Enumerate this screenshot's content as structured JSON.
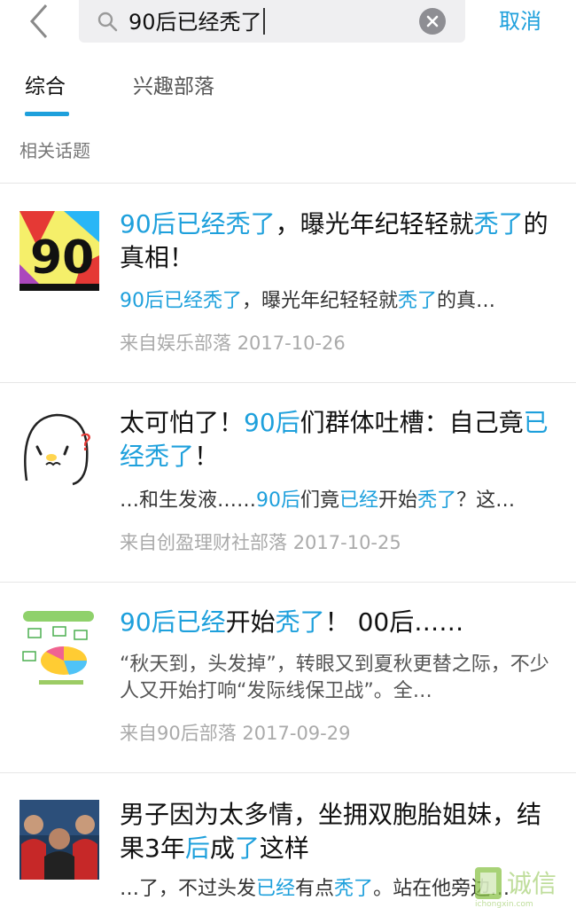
{
  "search": {
    "query": "90后已经秃了",
    "cancel_label": "取消"
  },
  "tabs": [
    {
      "label": "综合",
      "active": true
    },
    {
      "label": "兴趣部落",
      "active": false
    }
  ],
  "section_label": "相关话题",
  "results": [
    {
      "title": [
        [
          "90后已经秃了",
          true
        ],
        [
          "，曝光年纪轻轻就",
          false
        ],
        [
          "秃了",
          true
        ],
        [
          "的真相！",
          false
        ]
      ],
      "snippet": [
        [
          "90后已经秃了",
          true
        ],
        [
          "，曝光年纪轻轻就",
          false
        ],
        [
          "秃了",
          true
        ],
        [
          "的真…",
          false
        ]
      ],
      "source": "来自娱乐部落",
      "date": "2017-10-26",
      "thumb_text": "90"
    },
    {
      "title": [
        [
          "太可怕了！",
          false
        ],
        [
          "90后",
          true
        ],
        [
          "们群体吐槽：自己竟",
          false
        ],
        [
          "已经秃了",
          true
        ],
        [
          "！",
          false
        ]
      ],
      "snippet": [
        [
          "…和生发液……",
          false
        ],
        [
          "90后",
          true
        ],
        [
          "们竟",
          false
        ],
        [
          "已经",
          true
        ],
        [
          "开始",
          false
        ],
        [
          "秃了",
          true
        ],
        [
          "？这…",
          false
        ]
      ],
      "source": "来自创盈理财社部落",
      "date": "2017-10-25"
    },
    {
      "title": [
        [
          "90后已经",
          true
        ],
        [
          "开始",
          false
        ],
        [
          "秃了",
          true
        ],
        [
          "！ 00后……",
          false
        ]
      ],
      "snippet": [
        [
          "“秋天到，头发掉”，转眼又到夏秋更替之际，不少人又开始打响“发际线保卫战”。全…",
          false
        ]
      ],
      "source": "来自90后部落",
      "date": "2017-09-29"
    },
    {
      "title": [
        [
          "男子因为太多情，坐拥双胞胎姐妹，结果3年",
          false
        ],
        [
          "后",
          true
        ],
        [
          "成",
          false
        ],
        [
          "了",
          true
        ],
        [
          "这样",
          false
        ]
      ],
      "snippet": [
        [
          "…了，不过头发",
          false
        ],
        [
          "已经",
          true
        ],
        [
          "有点",
          false
        ],
        [
          "秃了",
          true
        ],
        [
          "。站在他旁边…",
          false
        ]
      ]
    }
  ],
  "watermark": {
    "text": "诚信",
    "subtext": "ichongxin.com"
  },
  "colors": {
    "accent": "#1ea0dc",
    "meta": "#aaaaaa"
  }
}
